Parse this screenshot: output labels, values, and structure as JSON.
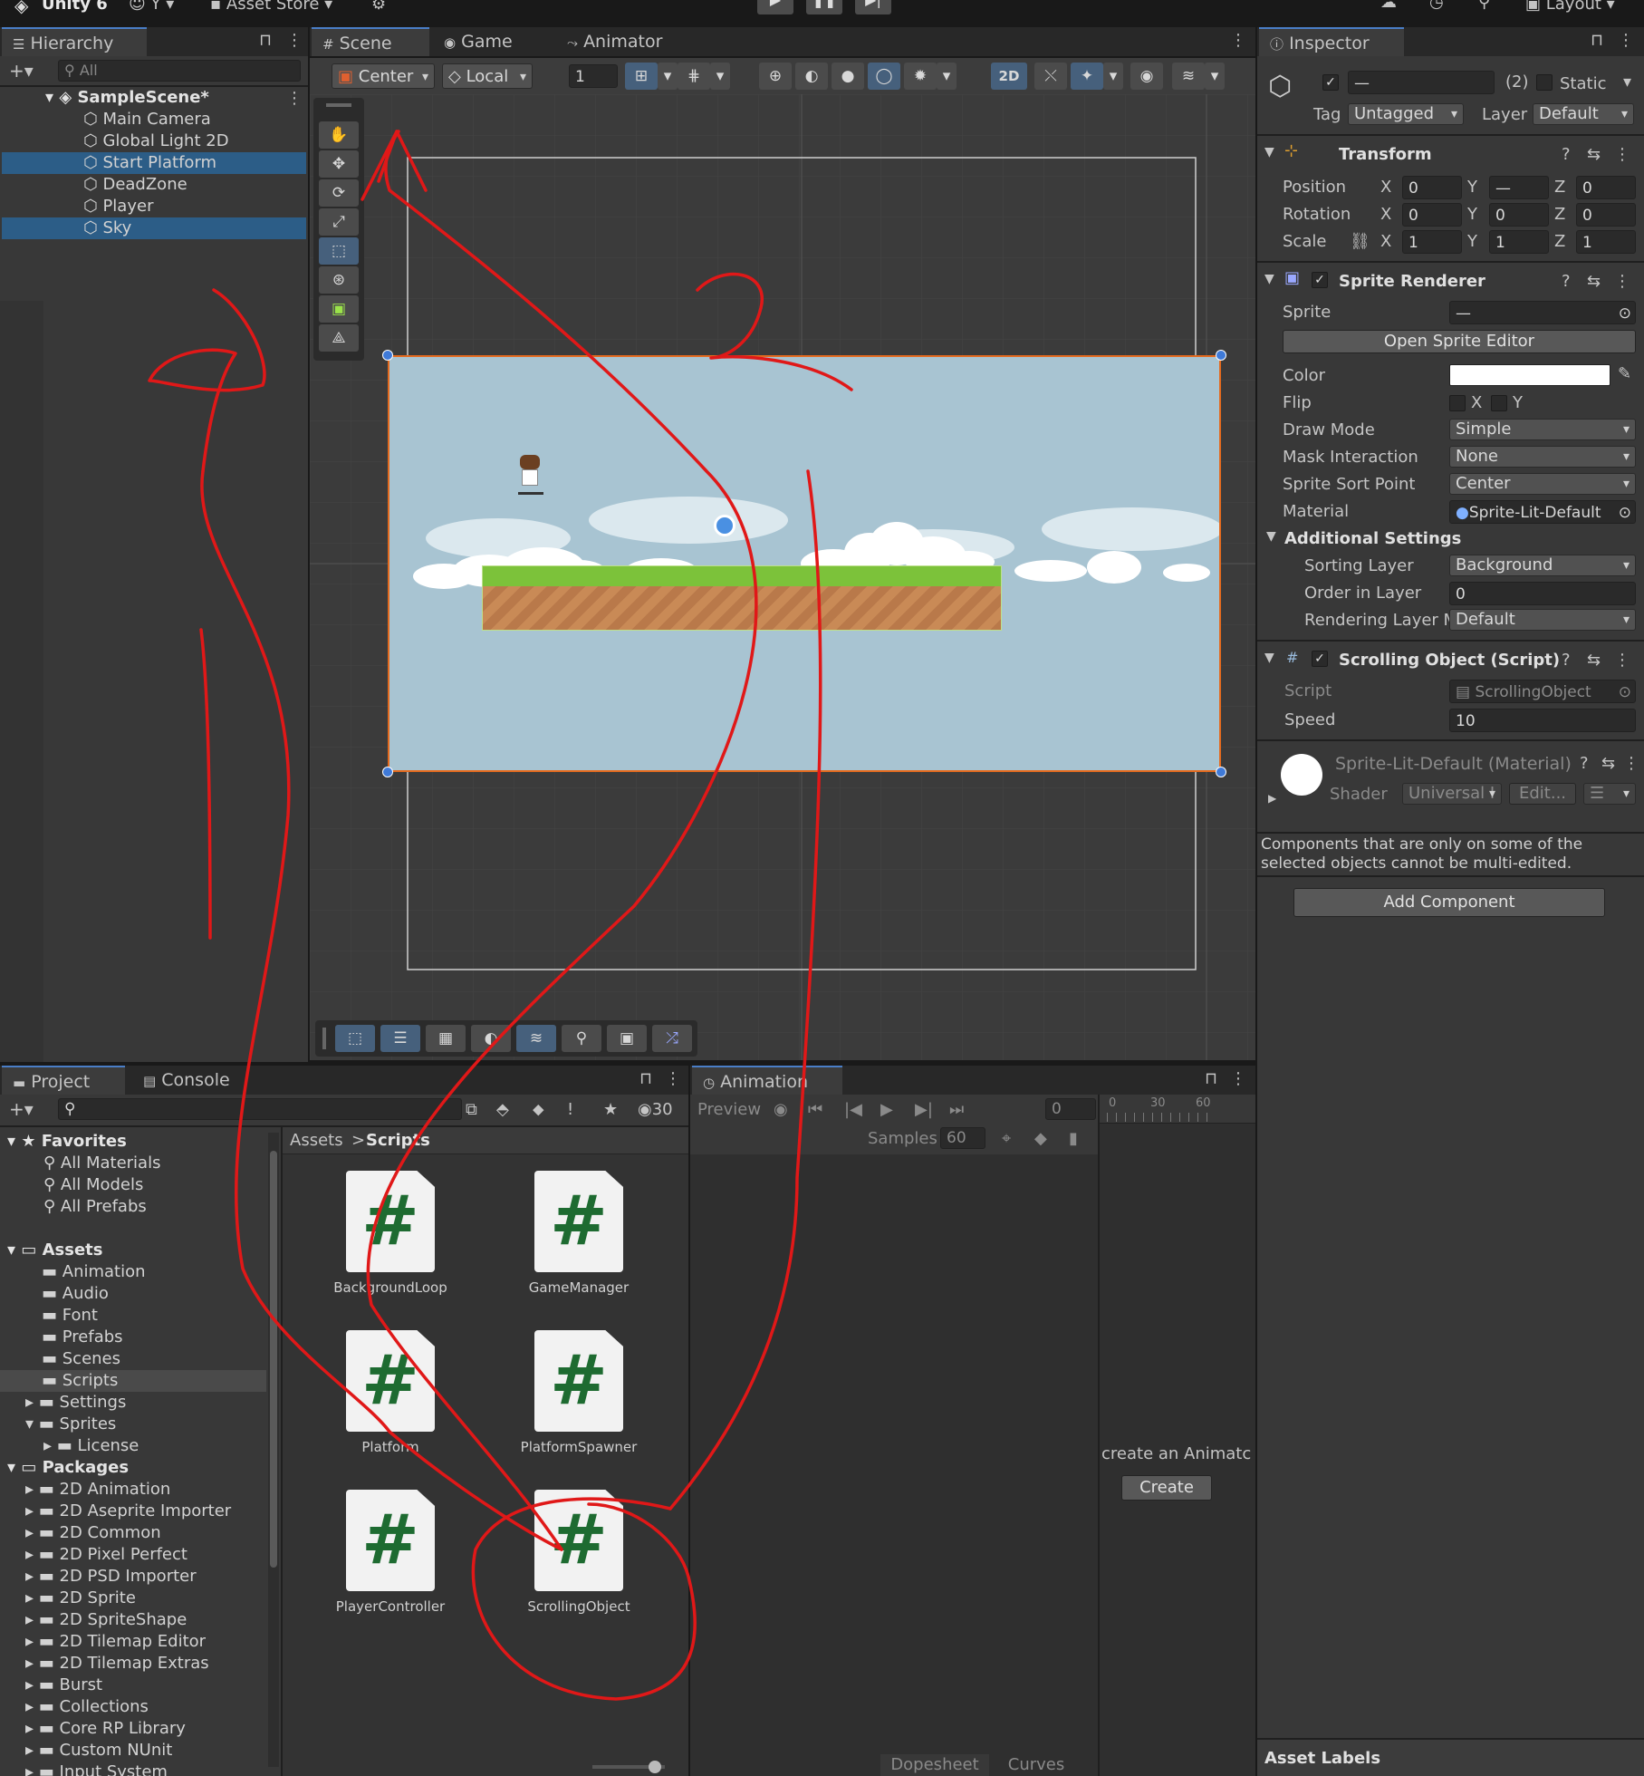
{
  "app": {
    "title": "Unity 6",
    "account": "Y",
    "asset_store": "Asset Store",
    "layout": "Layout"
  },
  "hierarchy": {
    "tab": "Hierarchy",
    "search_placeholder": "All",
    "scene": "SampleScene*",
    "items": [
      {
        "label": "Main Camera",
        "selected": false
      },
      {
        "label": "Global Light 2D",
        "selected": false
      },
      {
        "label": "Start Platform",
        "selected": true
      },
      {
        "label": "DeadZone",
        "selected": false
      },
      {
        "label": "Player",
        "selected": false
      },
      {
        "label": "Sky",
        "selected": true
      }
    ]
  },
  "scene_view": {
    "tabs": [
      "Scene",
      "Game",
      "Animator"
    ],
    "pivot": "Center",
    "space": "Local",
    "grid_snap": "1",
    "mode_2d": "2D"
  },
  "inspector": {
    "tab": "Inspector",
    "count": "(2)",
    "static_label": "Static",
    "name_placeholder": "—",
    "tag_label": "Tag",
    "tag_value": "Untagged",
    "layer_label": "Layer",
    "layer_value": "Default",
    "transform": {
      "title": "Transform",
      "position_label": "Position",
      "position": {
        "x": "0",
        "y": "—",
        "z": "0"
      },
      "rotation_label": "Rotation",
      "rotation": {
        "x": "0",
        "y": "0",
        "z": "0"
      },
      "scale_label": "Scale",
      "scale": {
        "x": "1",
        "y": "1",
        "z": "1"
      }
    },
    "sprite_renderer": {
      "title": "Sprite Renderer",
      "sprite_label": "Sprite",
      "sprite_value": "—",
      "open_editor": "Open Sprite Editor",
      "color_label": "Color",
      "flip_label": "Flip",
      "flip_x": "X",
      "flip_y": "Y",
      "draw_mode_label": "Draw Mode",
      "draw_mode": "Simple",
      "mask_label": "Mask Interaction",
      "mask": "None",
      "sort_point_label": "Sprite Sort Point",
      "sort_point": "Center",
      "material_label": "Material",
      "material": "Sprite-Lit-Default",
      "additional": "Additional Settings",
      "sorting_layer_label": "Sorting Layer",
      "sorting_layer": "Background",
      "order_label": "Order in Layer",
      "order": "0",
      "rendering_layer_label": "Rendering Layer M",
      "rendering_layer": "Default"
    },
    "scrolling": {
      "title": "Scrolling Object (Script)",
      "script_label": "Script",
      "script_value": "ScrollingObject",
      "speed_label": "Speed",
      "speed": "10"
    },
    "material_block": {
      "title": "Sprite-Lit-Default (Material)",
      "shader_label": "Shader",
      "shader": "Universal I",
      "edit": "Edit..."
    },
    "note": "Components that are only on some of the selected objects cannot be multi-edited.",
    "add_component": "Add Component",
    "asset_labels": "Asset Labels"
  },
  "project": {
    "tabs": [
      "Project",
      "Console"
    ],
    "hidden_count": "30",
    "breadcrumb": [
      "Assets",
      "Scripts"
    ],
    "favorites_label": "Favorites",
    "favorites": [
      "All Materials",
      "All Models",
      "All Prefabs"
    ],
    "assets_label": "Assets",
    "assets": [
      "Animation",
      "Audio",
      "Font",
      "Prefabs",
      "Scenes",
      "Scripts",
      "Settings",
      "Sprites"
    ],
    "sprites_child": "License",
    "packages_label": "Packages",
    "packages": [
      "2D Animation",
      "2D Aseprite Importer",
      "2D Common",
      "2D Pixel Perfect",
      "2D PSD Importer",
      "2D Sprite",
      "2D SpriteShape",
      "2D Tilemap Editor",
      "2D Tilemap Extras",
      "Burst",
      "Collections",
      "Core RP Library",
      "Custom NUnit",
      "Input System"
    ],
    "scripts": [
      "BackgroundLoop",
      "GameManager",
      "Platform",
      "PlatformSpawner",
      "PlayerController",
      "ScrollingObject"
    ]
  },
  "animation": {
    "tab": "Animation",
    "preview": "Preview",
    "frame": "0",
    "samples_label": "Samples",
    "samples": "60",
    "ruler": [
      "0",
      "30",
      "60"
    ],
    "create_text": "create an Animatc",
    "create_btn": "Create",
    "dopesheet": "Dopesheet",
    "curves": "Curves"
  },
  "colors": {
    "accent": "#2c5d87",
    "annotation": "#e01818",
    "sky": "#a8c4d2",
    "grass": "#7cc23a",
    "dirt": "#c98a56"
  }
}
